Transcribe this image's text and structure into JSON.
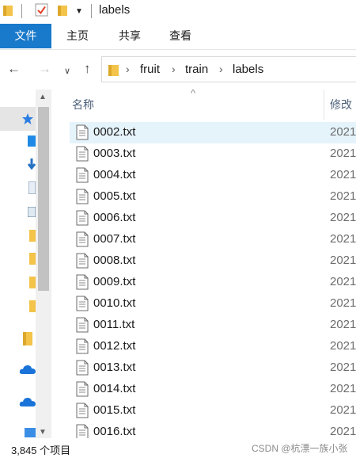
{
  "titlebar": {
    "title": "labels"
  },
  "ribbon": {
    "tabs": [
      "文件",
      "主页",
      "共享",
      "查看"
    ]
  },
  "navigation": {
    "breadcrumb": [
      "fruit",
      "train",
      "labels"
    ]
  },
  "file_list": {
    "columns": {
      "name": "名称",
      "modified": "修改"
    },
    "files": [
      {
        "name": "0002.txt",
        "modified": "2021"
      },
      {
        "name": "0003.txt",
        "modified": "2021"
      },
      {
        "name": "0004.txt",
        "modified": "2021"
      },
      {
        "name": "0005.txt",
        "modified": "2021"
      },
      {
        "name": "0006.txt",
        "modified": "2021"
      },
      {
        "name": "0007.txt",
        "modified": "2021"
      },
      {
        "name": "0008.txt",
        "modified": "2021"
      },
      {
        "name": "0009.txt",
        "modified": "2021"
      },
      {
        "name": "0010.txt",
        "modified": "2021"
      },
      {
        "name": "0011.txt",
        "modified": "2021"
      },
      {
        "name": "0012.txt",
        "modified": "2021"
      },
      {
        "name": "0013.txt",
        "modified": "2021"
      },
      {
        "name": "0014.txt",
        "modified": "2021"
      },
      {
        "name": "0015.txt",
        "modified": "2021"
      },
      {
        "name": "0016.txt",
        "modified": "2021"
      }
    ]
  },
  "status": {
    "item_count": "3,845 个项目",
    "watermark": "CSDN @杭漂一族小张"
  },
  "colors": {
    "accent": "#1979ca",
    "selection": "#e5f3fb",
    "folder": "#f3c34a"
  }
}
